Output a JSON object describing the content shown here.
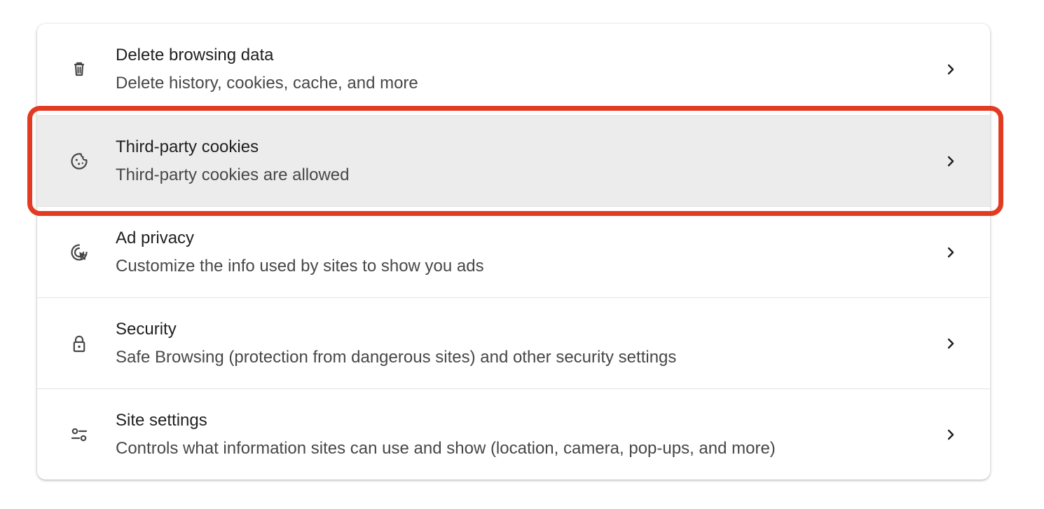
{
  "privacy_settings": {
    "items": [
      {
        "id": "delete-browsing-data",
        "title": "Delete browsing data",
        "subtitle": "Delete history, cookies, cache, and more",
        "icon": "trash-icon"
      },
      {
        "id": "third-party-cookies",
        "title": "Third-party cookies",
        "subtitle": "Third-party cookies are allowed",
        "icon": "cookie-icon",
        "highlighted": true
      },
      {
        "id": "ad-privacy",
        "title": "Ad privacy",
        "subtitle": "Customize the info used by sites to show you ads",
        "icon": "ad-privacy-icon"
      },
      {
        "id": "security",
        "title": "Security",
        "subtitle": "Safe Browsing (protection from dangerous sites) and other security settings",
        "icon": "lock-icon"
      },
      {
        "id": "site-settings",
        "title": "Site settings",
        "subtitle": "Controls what information sites can use and show (location, camera, pop-ups, and more)",
        "icon": "site-settings-icon"
      }
    ]
  },
  "colors": {
    "highlight_outline": "#e23b22",
    "active_row_background": "#ececec",
    "title_text": "#1f1f1f",
    "subtitle_text": "#474747",
    "icon": "#474747"
  }
}
